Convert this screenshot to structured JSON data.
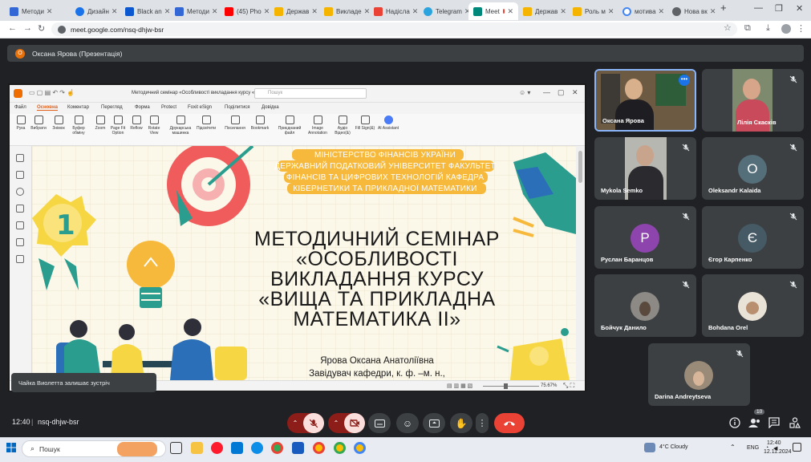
{
  "browser": {
    "tabs": [
      {
        "label": "Методи"
      },
      {
        "label": "Дизайн"
      },
      {
        "label": "Black an"
      },
      {
        "label": "Методи"
      },
      {
        "label": "(45) Pho"
      },
      {
        "label": "Держав"
      },
      {
        "label": "Викладе"
      },
      {
        "label": "Надісла"
      },
      {
        "label": "Telegram"
      },
      {
        "label": "Meet"
      },
      {
        "label": "Держав"
      },
      {
        "label": "Роль м"
      },
      {
        "label": "мотива"
      },
      {
        "label": "Нова вк"
      }
    ],
    "url": "meet.google.com/nsq-dhjw-bsr"
  },
  "meet": {
    "presenter_initial": "О",
    "presenter_label": "Оксана Ярова (Презентація)",
    "time": "12:40",
    "meeting_code": "nsq-dhjw-bsr",
    "participants_count": "10",
    "toast": "Чайка Виолетта залишає зустріч"
  },
  "participants": [
    {
      "name": "Оксана Ярова",
      "type": "video"
    },
    {
      "name": "Лілія Скасків",
      "type": "video"
    },
    {
      "name": "Mykola Semko",
      "type": "video"
    },
    {
      "name": "Oleksandr Kalaida",
      "type": "avatar",
      "initial": "O",
      "color": "#546e7a"
    },
    {
      "name": "Руслан Баранцов",
      "type": "avatar",
      "initial": "P",
      "color": "#8e44ad"
    },
    {
      "name": "Єгор Карпенко",
      "type": "avatar",
      "initial": "Є",
      "color": "#455a64"
    },
    {
      "name": "Бойчук Данило",
      "type": "photo"
    },
    {
      "name": "Bohdana Orel",
      "type": "photo"
    },
    {
      "name": "Darina Andreytseva",
      "type": "photo"
    }
  ],
  "foxit": {
    "doc_title": "Методичний семінар «Особливості викладання курсу «...",
    "search_placeholder": "Пошук",
    "menu": [
      "Файл",
      "Основна",
      "Коментар",
      "Перегляд",
      "Форма",
      "Protect",
      "Foxit eSign",
      "Поділитися",
      "Довідка"
    ],
    "ribbon": [
      "Рука",
      "Вибрати",
      "Знімок",
      "Буфер обміну",
      "Zoom",
      "Page Fit Option",
      "Reflow",
      "Rotate View",
      "Друкарська машинка",
      "Підсвітити",
      "Посилання",
      "Bookmark",
      "Приєднаний файл",
      "Image Annotation",
      "Аудіо Відео(&)",
      "Fill Sign(&)",
      "AI Assistant"
    ],
    "zoom": "75.67%"
  },
  "slide": {
    "ministry": [
      "МІНІСТЕРСТВО ФІНАНСІВ УКРАЇНИ",
      "ДЕРЖАВНИЙ ПОДАТКОВИЙ УНІВЕРСИТЕТ ФАКУЛЬТЕТ",
      "ФІНАНСІВ ТА ЦИФРОВИХ ТЕХНОЛОГІЙ КАФЕДРА",
      "КІБЕРНЕТИКИ ТА ПРИКЛАДНОЇ МАТЕМАТИКИ"
    ],
    "title": [
      "МЕТОДИЧНИЙ  СЕМІНАР",
      "«ОСОБЛИВОСТІ",
      "ВИКЛАДАННЯ  КУРСУ",
      "«ВИЩА  ТА  ПРИКЛАДНА",
      "МАТЕМАТИКА  ІІ»"
    ],
    "author": "Ярова Оксана Анатоліївна",
    "position": "Завідувач кафедри, к. ф. –м. н.,",
    "medal": "1"
  },
  "taskbar": {
    "search": "Пошук",
    "weather": "4°C  Cloudy",
    "lang": "ENG",
    "time": "12:40",
    "date": "12.11.2024"
  },
  "colors": {
    "meet_bg": "#202124",
    "tile_bg": "#3c4043",
    "hangup": "#ea4335",
    "mic_off": "#ea4335",
    "slide_orange": "#f6b93b",
    "slide_teal": "#2a9d8f"
  }
}
